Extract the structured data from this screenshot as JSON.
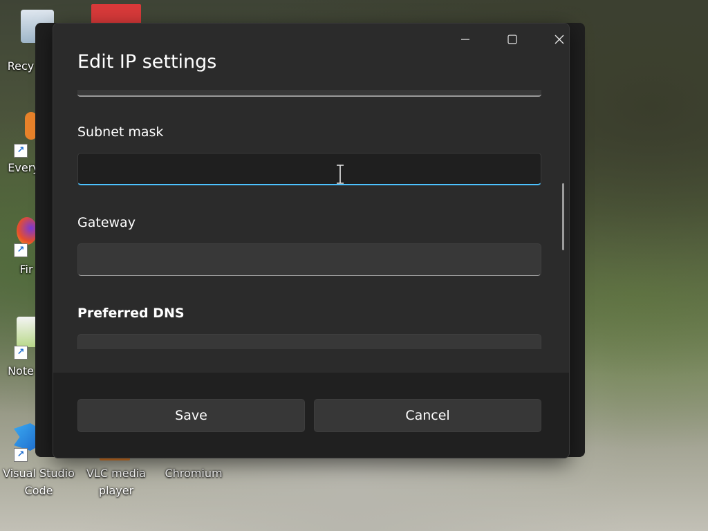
{
  "desktop": {
    "icons": [
      {
        "label": "Recy"
      },
      {
        "label": "Every"
      },
      {
        "label": "Fir"
      },
      {
        "label": "Note"
      },
      {
        "label": "Visual Studio Code"
      },
      {
        "label": "VLC media player"
      },
      {
        "label": "Chromium"
      }
    ]
  },
  "dialog": {
    "title": "Edit IP settings",
    "fields": {
      "subnet_label": "Subnet mask",
      "subnet_value": "",
      "gateway_label": "Gateway",
      "gateway_value": "",
      "dns_label": "Preferred DNS",
      "dns_value": ""
    },
    "buttons": {
      "save": "Save",
      "cancel": "Cancel"
    }
  },
  "colors": {
    "accent": "#4cc2ff",
    "dialog_bg": "#2b2b2b",
    "footer_bg": "#202020"
  }
}
